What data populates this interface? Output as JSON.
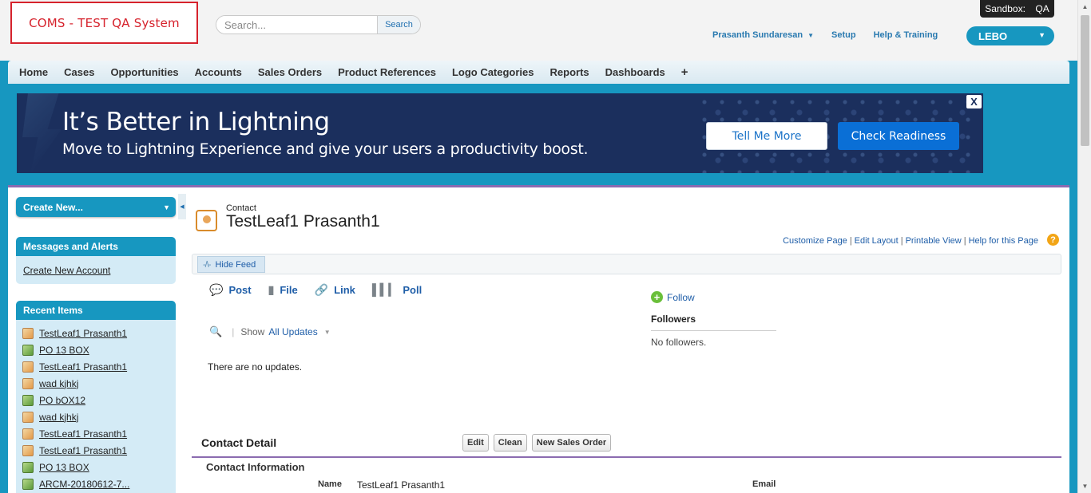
{
  "header": {
    "logo_text": "COMS - TEST QA System",
    "search_placeholder": "Search...",
    "search_button": "Search",
    "sandbox_label": "Sandbox:",
    "sandbox_value": "QA",
    "user_name": "Prasanth Sundaresan",
    "setup": "Setup",
    "help": "Help & Training",
    "app_name": "LEBO"
  },
  "nav": {
    "tabs": [
      "Home",
      "Cases",
      "Opportunities",
      "Accounts",
      "Sales Orders",
      "Product References",
      "Logo Categories",
      "Reports",
      "Dashboards"
    ],
    "plus": "+"
  },
  "banner": {
    "title": "It’s Better in Lightning",
    "subtitle": "Move to Lightning Experience and give your users a productivity boost.",
    "tell_me_more": "Tell Me More",
    "check_readiness": "Check Readiness",
    "close": "X"
  },
  "sidebar": {
    "create_new": "Create New...",
    "messages_title": "Messages and Alerts",
    "create_account_link": "Create New Account",
    "recent_title": "Recent Items",
    "recent_items": [
      {
        "label": "TestLeaf1 Prasanth1",
        "icon": "contact-icon"
      },
      {
        "label": "PO 13 BOX",
        "icon": "order-icon"
      },
      {
        "label": "TestLeaf1 Prasanth1",
        "icon": "contact-icon"
      },
      {
        "label": "wad kjhkj",
        "icon": "contact-icon"
      },
      {
        "label": "PO bOX12",
        "icon": "order-icon"
      },
      {
        "label": "wad kjhkj",
        "icon": "contact-icon"
      },
      {
        "label": "TestLeaf1 Prasanth1",
        "icon": "contact-icon"
      },
      {
        "label": "TestLeaf1 Prasanth1",
        "icon": "contact-icon"
      },
      {
        "label": "PO 13 BOX",
        "icon": "order-icon"
      },
      {
        "label": "ARCM-20180612-7...",
        "icon": "order-icon"
      }
    ]
  },
  "record": {
    "type": "Contact",
    "name": "TestLeaf1 Prasanth1",
    "links": [
      "Customize Page",
      "Edit Layout",
      "Printable View",
      "Help for this Page"
    ],
    "help_glyph": "?"
  },
  "feed": {
    "hide_feed": "Hide Feed",
    "publisher": [
      "Post",
      "File",
      "Link",
      "Poll"
    ],
    "show_label": "Show",
    "show_value": "All Updates",
    "no_updates": "There are no updates.",
    "follow": "Follow",
    "followers_title": "Followers",
    "no_followers": "No followers."
  },
  "detail": {
    "title": "Contact Detail",
    "buttons": [
      "Edit",
      "Clean",
      "New Sales Order"
    ],
    "section_title": "Contact Information",
    "name_label": "Name",
    "name_value": "TestLeaf1 Prasanth1",
    "email_label": "Email"
  },
  "colors": {
    "accent": "#1797c0",
    "banner_bg": "#1b2f5d",
    "logo_red": "#d6222c",
    "section_line": "#8b6bb0"
  }
}
